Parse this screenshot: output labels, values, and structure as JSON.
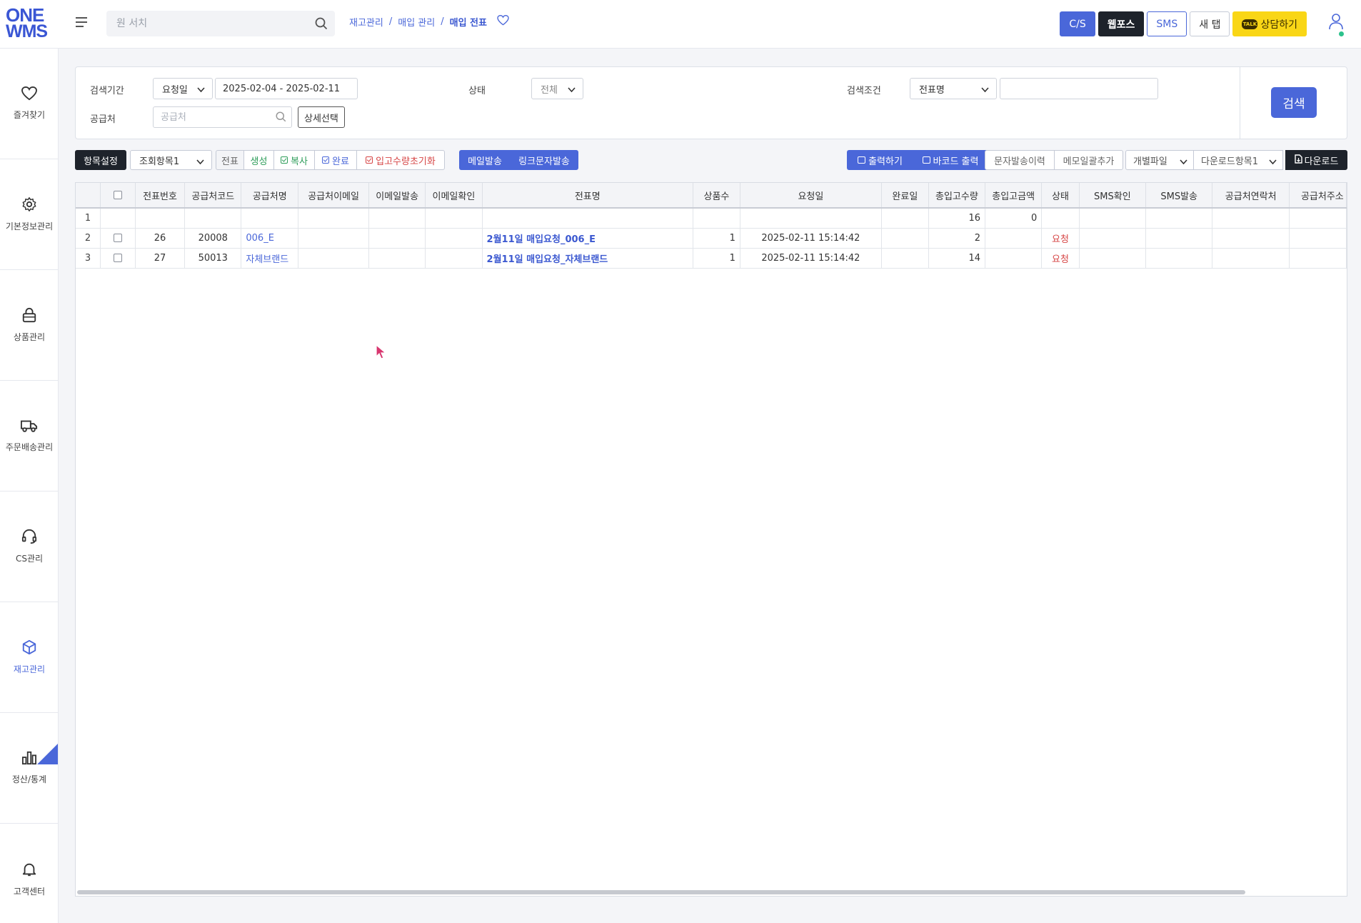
{
  "header": {
    "logo_line1": "ONE",
    "logo_line2": "WMS",
    "search_placeholder": "원 서치",
    "breadcrumb": [
      "재고관리",
      "매입 관리",
      "매입 전표"
    ],
    "buttons": {
      "cs": "C/S",
      "weps": "웹포스",
      "sms": "SMS",
      "new_tab": "새 탭",
      "consult": "상담하기",
      "talk_badge": "TALK"
    }
  },
  "sidebar": {
    "items": [
      {
        "label": "즐겨찾기",
        "icon": "heart-icon"
      },
      {
        "label": "기본정보관리",
        "icon": "gear-icon"
      },
      {
        "label": "상품관리",
        "icon": "lock-icon"
      },
      {
        "label": "주문배송관리",
        "icon": "truck-icon"
      },
      {
        "label": "CS관리",
        "icon": "headset-icon"
      },
      {
        "label": "재고관리",
        "icon": "box-icon",
        "active": true
      },
      {
        "label": "정산/통계",
        "icon": "bar-chart-icon"
      },
      {
        "label": "고객센터",
        "icon": "bell-icon"
      }
    ]
  },
  "filter": {
    "period_label": "검색기간",
    "period_type": "요청일",
    "date_range": "2025-02-04 - 2025-02-11",
    "status_label": "상태",
    "status_value": "전체",
    "condition_label": "검색조건",
    "condition_value": "전표명",
    "condition_input": "",
    "supplier_label": "공급처",
    "supplier_placeholder": "공급처",
    "detail_button": "상세선택",
    "search_button": "검색"
  },
  "toolbar": {
    "item_settings": "항목설정",
    "view_items": "조회항목1",
    "slip": "전표",
    "create": "생성",
    "copy": "복사",
    "complete": "완료",
    "reset_qty": "입고수량초기화",
    "mail_send": "메일발송",
    "link_sms": "링크문자발송",
    "print": "출력하기",
    "barcode_print": "바코드 출력",
    "sms_history": "문자발송이력",
    "memo_bulk": "메모일괄추가",
    "individual_file": "개별파일",
    "download_items": "다운로드항목1",
    "download": "다운로드"
  },
  "grid": {
    "columns": [
      "",
      "",
      "전표번호",
      "공급처코드",
      "공급처명",
      "공급처이메일",
      "이메일발송",
      "이메일확인",
      "전표명",
      "상품수",
      "요청일",
      "완료일",
      "총입고수량",
      "총입고금액",
      "상태",
      "SMS확인",
      "SMS발송",
      "공급처연락처",
      "공급처주소"
    ],
    "summary": {
      "rownum": "1",
      "total_qty": "16",
      "total_amount": "0"
    },
    "rows": [
      {
        "rownum": "2",
        "slip_no": "26",
        "supplier_code": "20008",
        "supplier_name": "006_E",
        "supplier_email": "",
        "email_sent": "",
        "email_checked": "",
        "slip_name": "2월11일 매입요청_006_E",
        "item_count": "1",
        "request_date": "2025-02-11 15:14:42",
        "complete_date": "",
        "total_qty": "2",
        "total_amount": "",
        "status": "요청"
      },
      {
        "rownum": "3",
        "slip_no": "27",
        "supplier_code": "50013",
        "supplier_name": "자체브랜드",
        "supplier_email": "",
        "email_sent": "",
        "email_checked": "",
        "slip_name": "2월11일 매입요청_자체브랜드",
        "item_count": "1",
        "request_date": "2025-02-11 15:14:42",
        "complete_date": "",
        "total_qty": "14",
        "total_amount": "",
        "status": "요청"
      }
    ]
  },
  "colors": {
    "accent": "#4a67d9",
    "dark": "#1e232b",
    "status_red": "#d64545",
    "talk_yellow": "#f9d616",
    "green": "#2e9d5a"
  }
}
